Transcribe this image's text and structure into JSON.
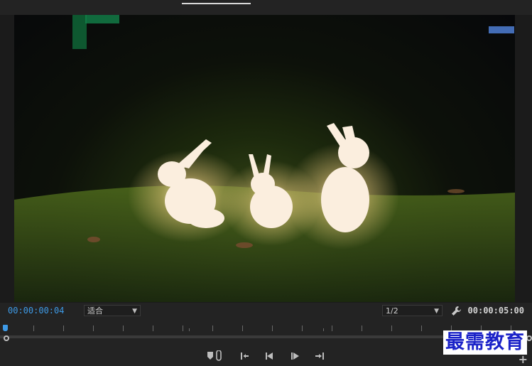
{
  "monitor": {
    "current_timecode": "00:00:00:04",
    "duration_timecode": "00:00:05:00",
    "zoom_select": "适合",
    "resolution_select": "1/2",
    "frame_content": "three-glowing-rabbit-lanterns-on-grass-at-night"
  },
  "transport": {
    "buttons": [
      {
        "name": "add-marker-button",
        "icon": "marker-icon"
      },
      {
        "name": "go-to-in-button",
        "icon": "go-to-in-icon"
      },
      {
        "name": "step-back-button",
        "icon": "step-back-icon"
      },
      {
        "name": "play-button",
        "icon": "play-icon"
      },
      {
        "name": "go-to-out-button",
        "icon": "go-to-out-icon"
      },
      {
        "name": "button-editor",
        "icon": "plus-icon"
      }
    ],
    "add_symbol": "+"
  },
  "watermark": {
    "text": "最需教育"
  },
  "colors": {
    "accent_timecode": "#3e9ae6",
    "panel_bg": "#232323",
    "watermark_text": "#1b22c8"
  }
}
